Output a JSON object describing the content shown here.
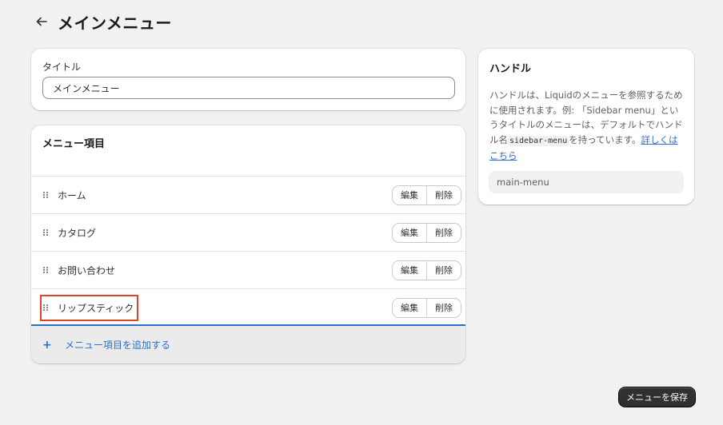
{
  "header": {
    "back_icon": "arrow-left-icon",
    "title": "メインメニュー"
  },
  "title_card": {
    "label": "タイトル",
    "value": "メインメニュー"
  },
  "menu_card": {
    "title": "メニュー項目",
    "items": [
      {
        "label": "ホーム",
        "edit": "編集",
        "delete": "削除"
      },
      {
        "label": "カタログ",
        "edit": "編集",
        "delete": "削除"
      },
      {
        "label": "お問い合わせ",
        "edit": "編集",
        "delete": "削除"
      },
      {
        "label": "リップスティック",
        "edit": "編集",
        "delete": "削除"
      }
    ],
    "add_icon": "+",
    "add_label": "メニュー項目を追加する"
  },
  "handle_card": {
    "title": "ハンドル",
    "desc_part1": "ハンドルは、Liquidのメニューを参照するために使用されます。例: 「Sidebar menu」というタイトルのメニューは、デフォルトでハンドル名",
    "code": "sidebar-menu",
    "desc_part2": "を持っています。",
    "link": "詳しくはこちら",
    "value": "main-menu"
  },
  "footer": {
    "save_label": "メニューを保存"
  },
  "colors": {
    "accent": "#2c6ecb",
    "highlight": "#e0432b",
    "primary_button": "#303030"
  }
}
